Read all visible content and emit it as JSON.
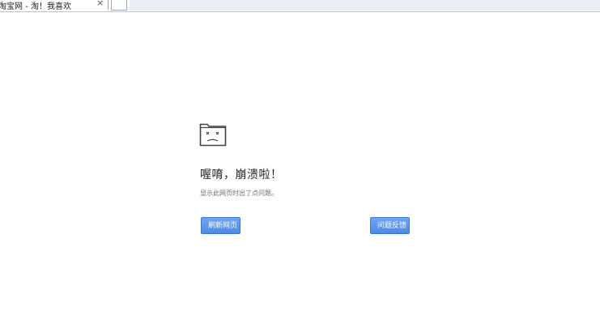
{
  "tab": {
    "title": "淘宝网 - 淘！我喜欢",
    "close_glyph": "×"
  },
  "crash": {
    "title": "喔唷，崩溃啦！",
    "description": "显示此网页时出了点问题。",
    "reload_label": "刷新网页",
    "feedback_label": "问题反馈",
    "icon": "sad-folder-icon"
  },
  "colors": {
    "button_bg": "#5a95ea",
    "button_border": "#3f78cc",
    "title_text": "#222222",
    "desc_text": "#707070"
  }
}
